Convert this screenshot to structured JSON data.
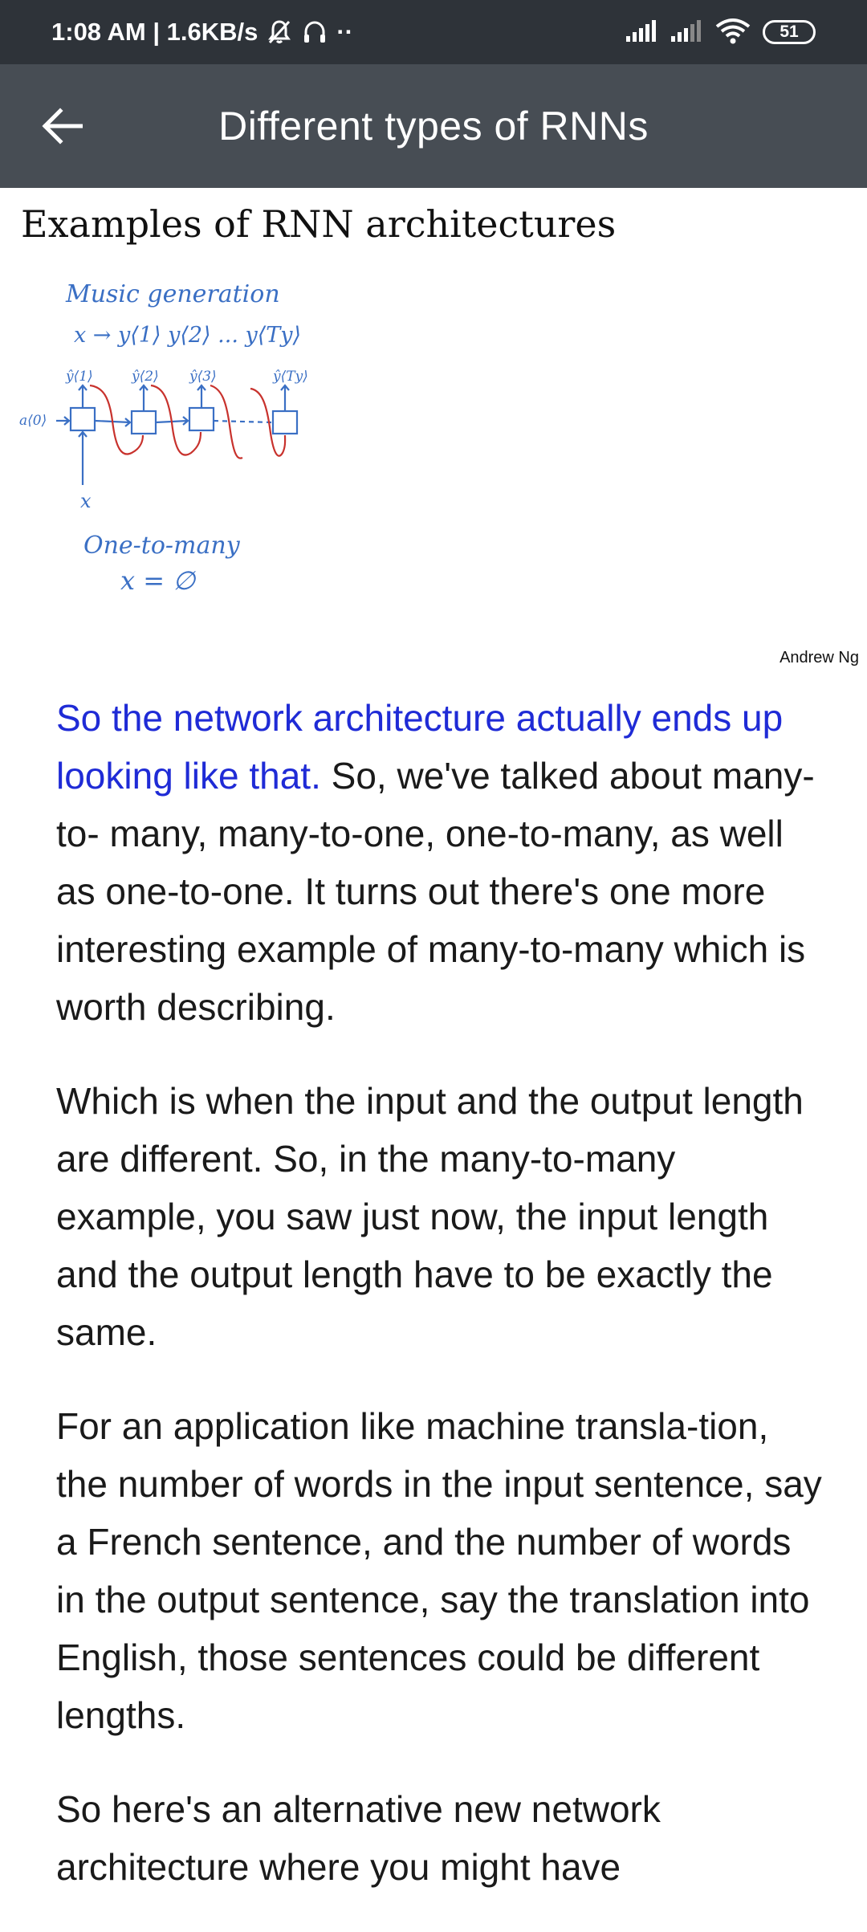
{
  "status_bar": {
    "time_speed": "1:08 AM | 1.6KB/s",
    "extra": "··",
    "battery": "51"
  },
  "app_bar": {
    "title": "Different types of RNNs"
  },
  "slide": {
    "title": "Examples of RNN architectures",
    "credit": "Andrew Ng",
    "handwriting": {
      "heading": "Music generation",
      "formula": "x → y⟨1⟩ y⟨2⟩ ... y⟨Ty⟩",
      "outputs": [
        "ŷ⟨1⟩",
        "ŷ⟨2⟩",
        "ŷ⟨3⟩",
        "ŷ⟨Ty⟩"
      ],
      "init_state": "a⟨0⟩",
      "input": "x",
      "caption": "One-to-many",
      "empty_input": "x = ∅"
    }
  },
  "transcript": {
    "p1_highlight": "So the network architecture actually ends up looking like that.",
    "p1_rest": " So, we've talked about many-to- many, many-to-one, one-to-many, as well as one-to-one. It turns out there's one more interesting example of many-to-many which is worth describing.",
    "p2": "Which is when the input and the output length are different. So, in the many-to-many example, you saw just now, the input length and the output length have to be exactly the same.",
    "p3": "For an application like machine transla-tion, the number of words in the input sentence, say a French sentence, and the number of words in the output sentence, say the translation into English, those sentences could be different lengths.",
    "p4": "So here's an alternative new network architecture where you might have"
  },
  "colors": {
    "status_bar_bg": "#2e3339",
    "app_bar_bg": "#474d54",
    "highlight_text": "#1f2bd6",
    "sketch_blue": "#3a6fc4",
    "sketch_red": "#c8322d"
  }
}
